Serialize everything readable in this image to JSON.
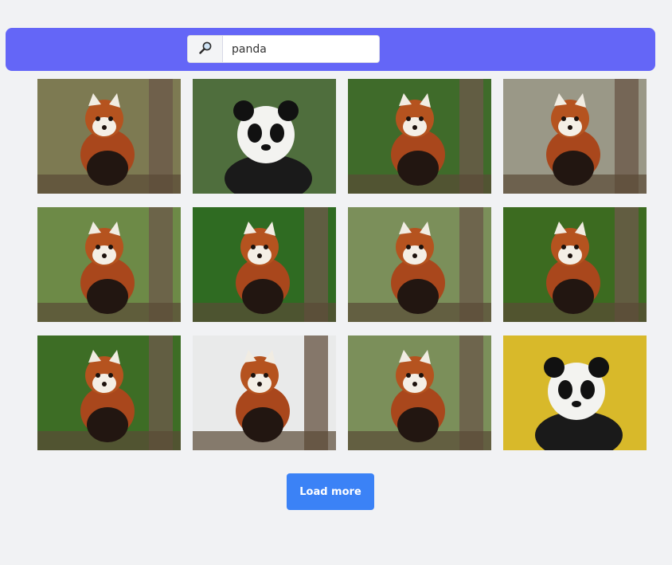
{
  "search": {
    "button_icon": "magnifier-icon",
    "query": "panda"
  },
  "gallery": {
    "images": [
      {
        "subject": "red-panda",
        "bg": "#7d7a52"
      },
      {
        "subject": "giant-panda",
        "bg": "#4f6e3d"
      },
      {
        "subject": "red-panda",
        "bg": "#3f6b2a"
      },
      {
        "subject": "red-panda",
        "bg": "#9a9887"
      },
      {
        "subject": "red-panda",
        "bg": "#6d8a47"
      },
      {
        "subject": "red-panda",
        "bg": "#2f6b22"
      },
      {
        "subject": "red-panda",
        "bg": "#7b8f5a"
      },
      {
        "subject": "red-panda",
        "bg": "#3c6b20"
      },
      {
        "subject": "red-panda",
        "bg": "#3d6d25"
      },
      {
        "subject": "red-panda",
        "bg": "#e9eaea"
      },
      {
        "subject": "red-panda",
        "bg": "#7b8f5a"
      },
      {
        "subject": "giant-panda",
        "bg": "#d8b92a"
      }
    ]
  },
  "pagination": {
    "load_more_label": "Load more"
  },
  "colors": {
    "header_bg": "#6466f7",
    "page_bg": "#f1f2f4",
    "button_bg": "#3b82f6"
  }
}
